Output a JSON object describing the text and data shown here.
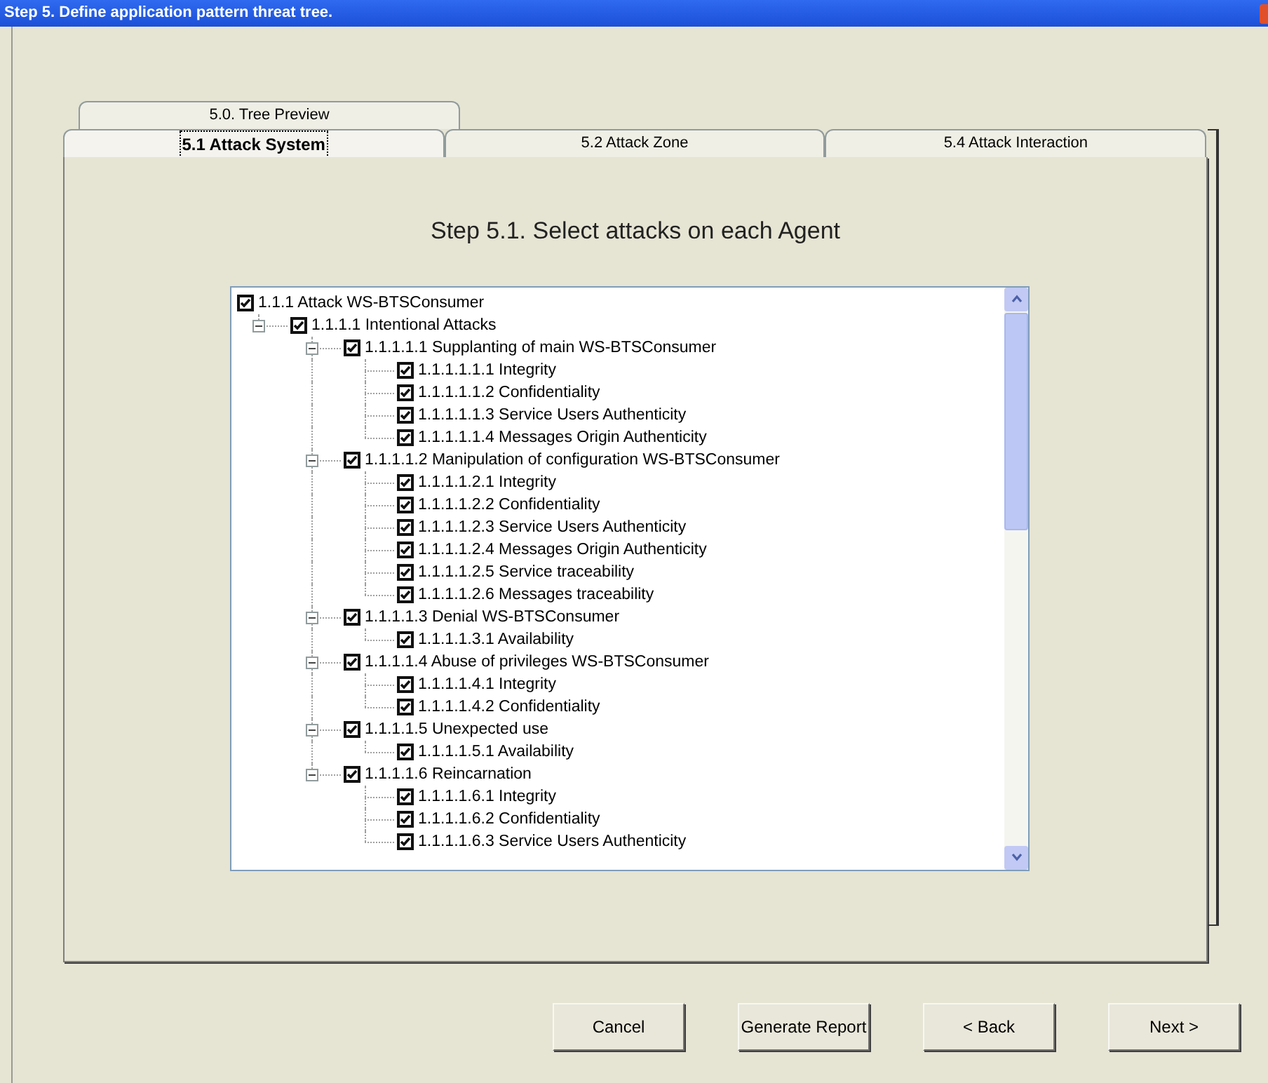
{
  "window": {
    "title": "Step 5. Define application pattern threat tree."
  },
  "tab_rows": [
    [
      {
        "label": "5.0. Tree Preview",
        "selected": false
      }
    ],
    [
      {
        "label": "5.1 Attack System",
        "selected": true
      },
      {
        "label": "5.2 Attack Zone",
        "selected": false
      },
      {
        "label": "5.4 Attack Interaction",
        "selected": false
      }
    ]
  ],
  "heading": "Step 5.1. Select attacks on each Agent",
  "tree": [
    {
      "label": "1.1.1 Attack WS-BTSConsumer",
      "checked": true,
      "children": [
        {
          "label": "1.1.1.1 Intentional Attacks",
          "checked": true,
          "expanded": true,
          "children": [
            {
              "label": "1.1.1.1.1 Supplanting of main WS-BTSConsumer",
              "checked": true,
              "expanded": true,
              "children": [
                {
                  "label": "1.1.1.1.1.1 Integrity",
                  "checked": true
                },
                {
                  "label": "1.1.1.1.1.2 Confidentiality",
                  "checked": true
                },
                {
                  "label": "1.1.1.1.1.3 Service Users Authenticity",
                  "checked": true
                },
                {
                  "label": "1.1.1.1.1.4 Messages Origin Authenticity",
                  "checked": true
                }
              ]
            },
            {
              "label": "1.1.1.1.2 Manipulation of configuration WS-BTSConsumer",
              "checked": true,
              "expanded": true,
              "children": [
                {
                  "label": "1.1.1.1.2.1 Integrity",
                  "checked": true
                },
                {
                  "label": "1.1.1.1.2.2 Confidentiality",
                  "checked": true
                },
                {
                  "label": "1.1.1.1.2.3 Service Users Authenticity",
                  "checked": true
                },
                {
                  "label": "1.1.1.1.2.4 Messages Origin Authenticity",
                  "checked": true
                },
                {
                  "label": "1.1.1.1.2.5 Service traceability",
                  "checked": true
                },
                {
                  "label": "1.1.1.1.2.6 Messages traceability",
                  "checked": true
                }
              ]
            },
            {
              "label": "1.1.1.1.3 Denial WS-BTSConsumer",
              "checked": true,
              "expanded": true,
              "children": [
                {
                  "label": "1.1.1.1.3.1 Availability",
                  "checked": true
                }
              ]
            },
            {
              "label": "1.1.1.1.4 Abuse of privileges WS-BTSConsumer",
              "checked": true,
              "expanded": true,
              "children": [
                {
                  "label": "1.1.1.1.4.1 Integrity",
                  "checked": true
                },
                {
                  "label": "1.1.1.1.4.2 Confidentiality",
                  "checked": true
                }
              ]
            },
            {
              "label": "1.1.1.1.5 Unexpected use",
              "checked": true,
              "expanded": true,
              "children": [
                {
                  "label": "1.1.1.1.5.1 Availability",
                  "checked": true
                }
              ]
            },
            {
              "label": "1.1.1.1.6 Reincarnation",
              "checked": true,
              "expanded": true,
              "children": [
                {
                  "label": "1.1.1.1.6.1 Integrity",
                  "checked": true
                },
                {
                  "label": "1.1.1.1.6.2 Confidentiality",
                  "checked": true
                },
                {
                  "label": "1.1.1.1.6.3 Service Users Authenticity",
                  "checked": true
                }
              ]
            }
          ]
        }
      ]
    }
  ],
  "buttons": [
    {
      "label": "Cancel"
    },
    {
      "label": "Generate Report"
    },
    {
      "label": "< Back"
    },
    {
      "label": "Next >"
    }
  ]
}
